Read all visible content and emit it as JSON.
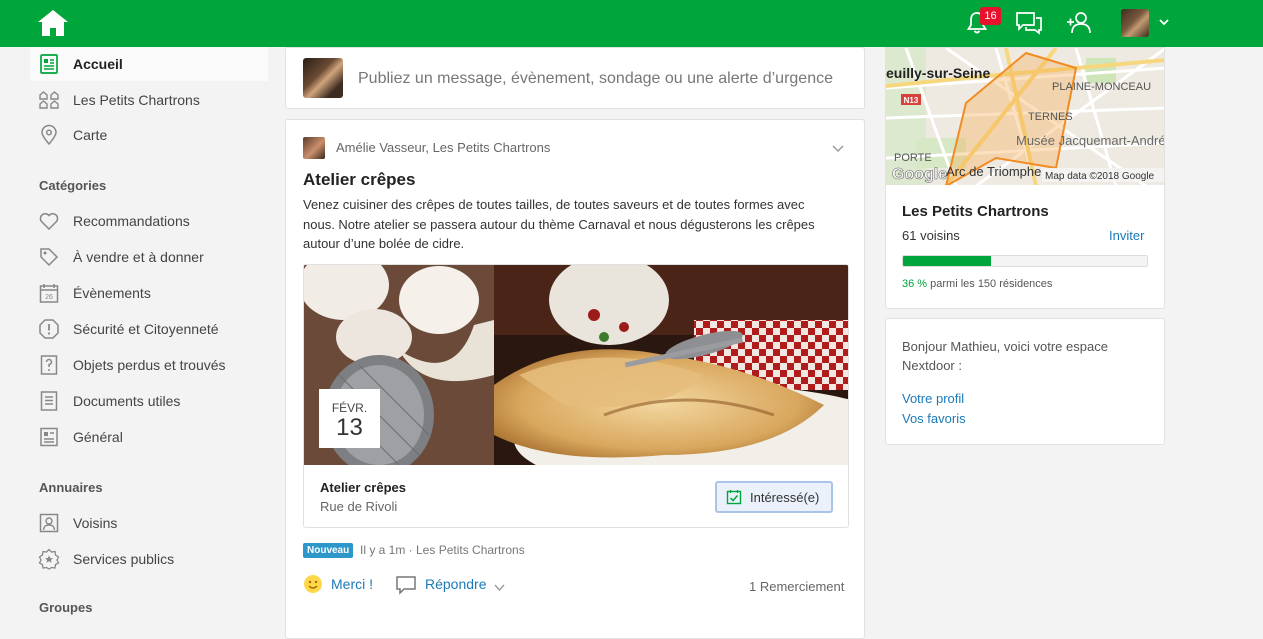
{
  "header": {
    "notifications_count": "16"
  },
  "sidebar": {
    "items": [
      {
        "label": "Accueil",
        "icon": "newspaper-icon"
      },
      {
        "label": "Les Petits Chartrons",
        "icon": "neighborhood-icon"
      },
      {
        "label": "Carte",
        "icon": "map-pin-icon"
      }
    ],
    "categories_title": "Catégories",
    "categories": [
      {
        "label": "Recommandations",
        "icon": "heart-icon"
      },
      {
        "label": "À vendre et à donner",
        "icon": "tag-icon"
      },
      {
        "label": "Évènements",
        "icon": "calendar-icon"
      },
      {
        "label": "Sécurité et Citoyenneté",
        "icon": "shield-alert-icon"
      },
      {
        "label": "Objets perdus et trouvés",
        "icon": "question-icon"
      },
      {
        "label": "Documents utiles",
        "icon": "document-icon"
      },
      {
        "label": "Général",
        "icon": "general-icon"
      }
    ],
    "directories_title": "Annuaires",
    "directories": [
      {
        "label": "Voisins",
        "icon": "person-icon"
      },
      {
        "label": "Services publics",
        "icon": "badge-icon"
      }
    ],
    "groups_title": "Groupes"
  },
  "composer": {
    "placeholder": "Publiez un message, évènement, sondage ou une alerte d’urgence"
  },
  "post": {
    "author": "Amélie Vasseur, Les Petits Chartrons",
    "title": "Atelier crêpes",
    "body": "Venez cuisiner des crêpes de toutes tailles, de toutes saveurs et de toutes formes avec nous. Notre atelier se passera autour du thème Carnaval et nous dégusterons les crêpes autour d’une bolée de cidre.",
    "event": {
      "month": "FÉVR.",
      "day": "13",
      "title": "Atelier crêpes",
      "place": "Rue de Rivoli",
      "interested_label": "Intéressé(e)"
    },
    "badge": "Nouveau",
    "meta": "Il y a 1m · Les Petits Chartrons",
    "thanks_label": "Merci !",
    "reply_label": "Répondre",
    "thanks_count": "1 Remerciement"
  },
  "map": {
    "labels": [
      "euilly-sur-Seine",
      "PLAINE-MONCEAU",
      "TERNES",
      "Musée Jacquemart-André",
      "PORTE",
      "Arc de Triomphe",
      "N13",
      "Google",
      "Map data ©2018 Google"
    ]
  },
  "neighborhood": {
    "name": "Les Petits Chartrons",
    "voisins": "61 voisins",
    "invite": "Inviter",
    "progress": 0.36,
    "pct": "36 %",
    "pct_rest": " parmi les 150 résidences"
  },
  "welcome": {
    "message": "Bonjour Mathieu, voici votre espace Nextdoor :",
    "link_profile": "Votre profil",
    "link_favorites": "Vos favoris"
  },
  "colors": {
    "brand": "#00a53c",
    "link": "#1a7ab8",
    "badge": "#e8112d"
  }
}
